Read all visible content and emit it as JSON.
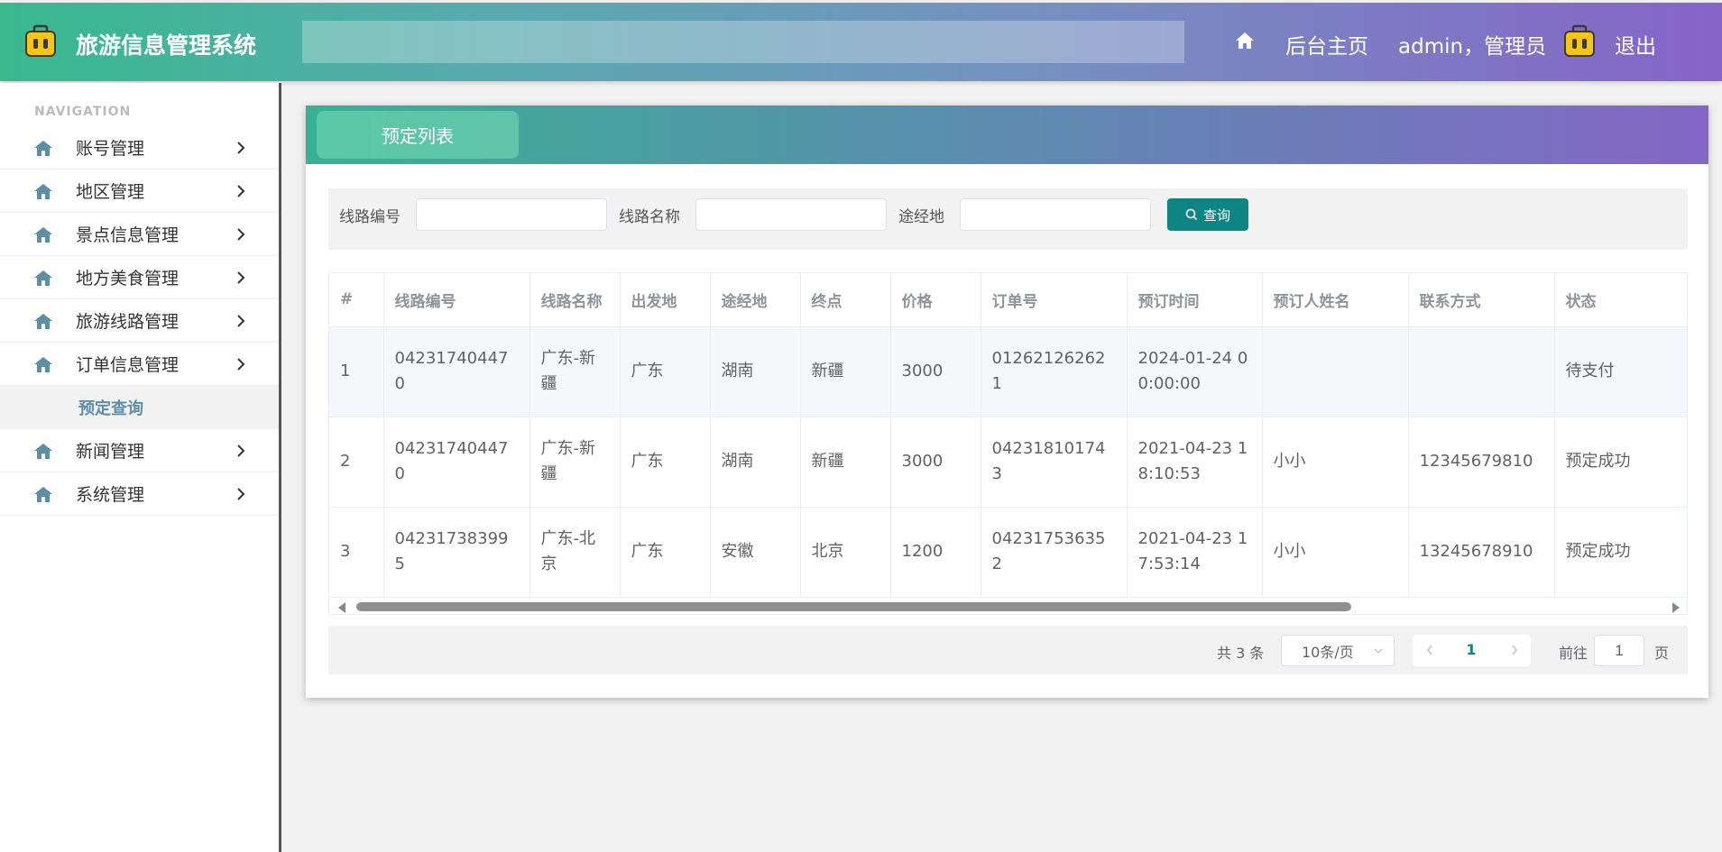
{
  "header": {
    "app_title": "旅游信息管理系统",
    "nav_home": "后台主页",
    "user": "admin，管理员",
    "logout": "退出"
  },
  "sidebar": {
    "heading": "NAVIGATION",
    "items": [
      {
        "label": "账号管理"
      },
      {
        "label": "地区管理"
      },
      {
        "label": "景点信息管理"
      },
      {
        "label": "地方美食管理"
      },
      {
        "label": "旅游线路管理"
      },
      {
        "label": "订单信息管理"
      },
      {
        "label": "新闻管理"
      },
      {
        "label": "系统管理"
      }
    ],
    "active_subitem": "预定查询"
  },
  "panel": {
    "tab_label": "预定列表"
  },
  "search": {
    "route_no_label": "线路编号",
    "route_name_label": "线路名称",
    "via_label": "途经地",
    "button_label": "查询"
  },
  "table": {
    "columns": [
      "#",
      "线路编号",
      "线路名称",
      "出发地",
      "途经地",
      "终点",
      "价格",
      "订单号",
      "预订时间",
      "预订人姓名",
      "联系方式",
      "状态"
    ],
    "rows": [
      [
        "1",
        "042317404470",
        "广东-新疆",
        "广东",
        "湖南",
        "新疆",
        "3000",
        "012621262621",
        "2024-01-24 00:00:00",
        "",
        "",
        "待支付"
      ],
      [
        "2",
        "042317404470",
        "广东-新疆",
        "广东",
        "湖南",
        "新疆",
        "3000",
        "042318101743",
        "2021-04-23 18:10:53",
        "小小",
        "12345679810",
        "预定成功"
      ],
      [
        "3",
        "042317383995",
        "广东-北京",
        "广东",
        "安徽",
        "北京",
        "1200",
        "042317536352",
        "2021-04-23 17:53:14",
        "小小",
        "13245678910",
        "预定成功"
      ]
    ]
  },
  "pagination": {
    "total": "共 3 条",
    "page_size": "10条/页",
    "current_page": "1",
    "goto_label": "前往",
    "goto_value": "1",
    "page_suffix": "页"
  },
  "colors": {
    "accent": "#0e8583",
    "header_start": "#38b98e",
    "header_end": "#8664c8"
  },
  "icons": {
    "logo": "suitcase-icon",
    "home": "home-icon",
    "menu": "house-icon",
    "arrow": "chevron-right-icon",
    "search": "search-icon"
  }
}
